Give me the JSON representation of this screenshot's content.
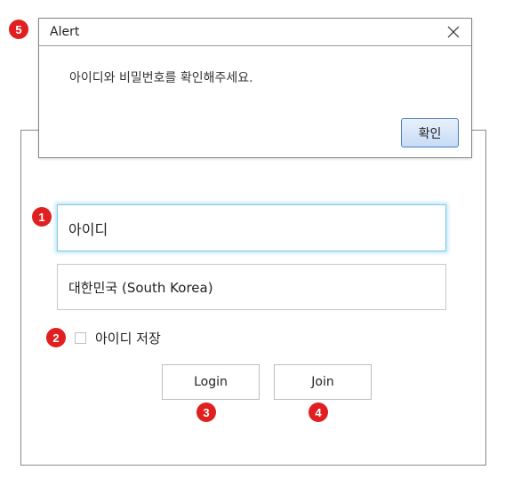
{
  "login": {
    "id_field_value": "아이디",
    "country_field_value": "대한민국 (South Korea)",
    "remember_label": "아이디 저장",
    "remember_checked": false,
    "login_label": "Login",
    "join_label": "Join"
  },
  "alert": {
    "title": "Alert",
    "message": "아이디와 비밀번호를 확인해주세요.",
    "ok_label": "확인"
  },
  "badges": [
    "1",
    "2",
    "3",
    "4",
    "5"
  ],
  "colors": {
    "badge": "#e02020",
    "focus_glow": "#bfe6f7",
    "ok_button_border": "#4a7bc4"
  },
  "icons": {
    "close": "close-icon"
  }
}
